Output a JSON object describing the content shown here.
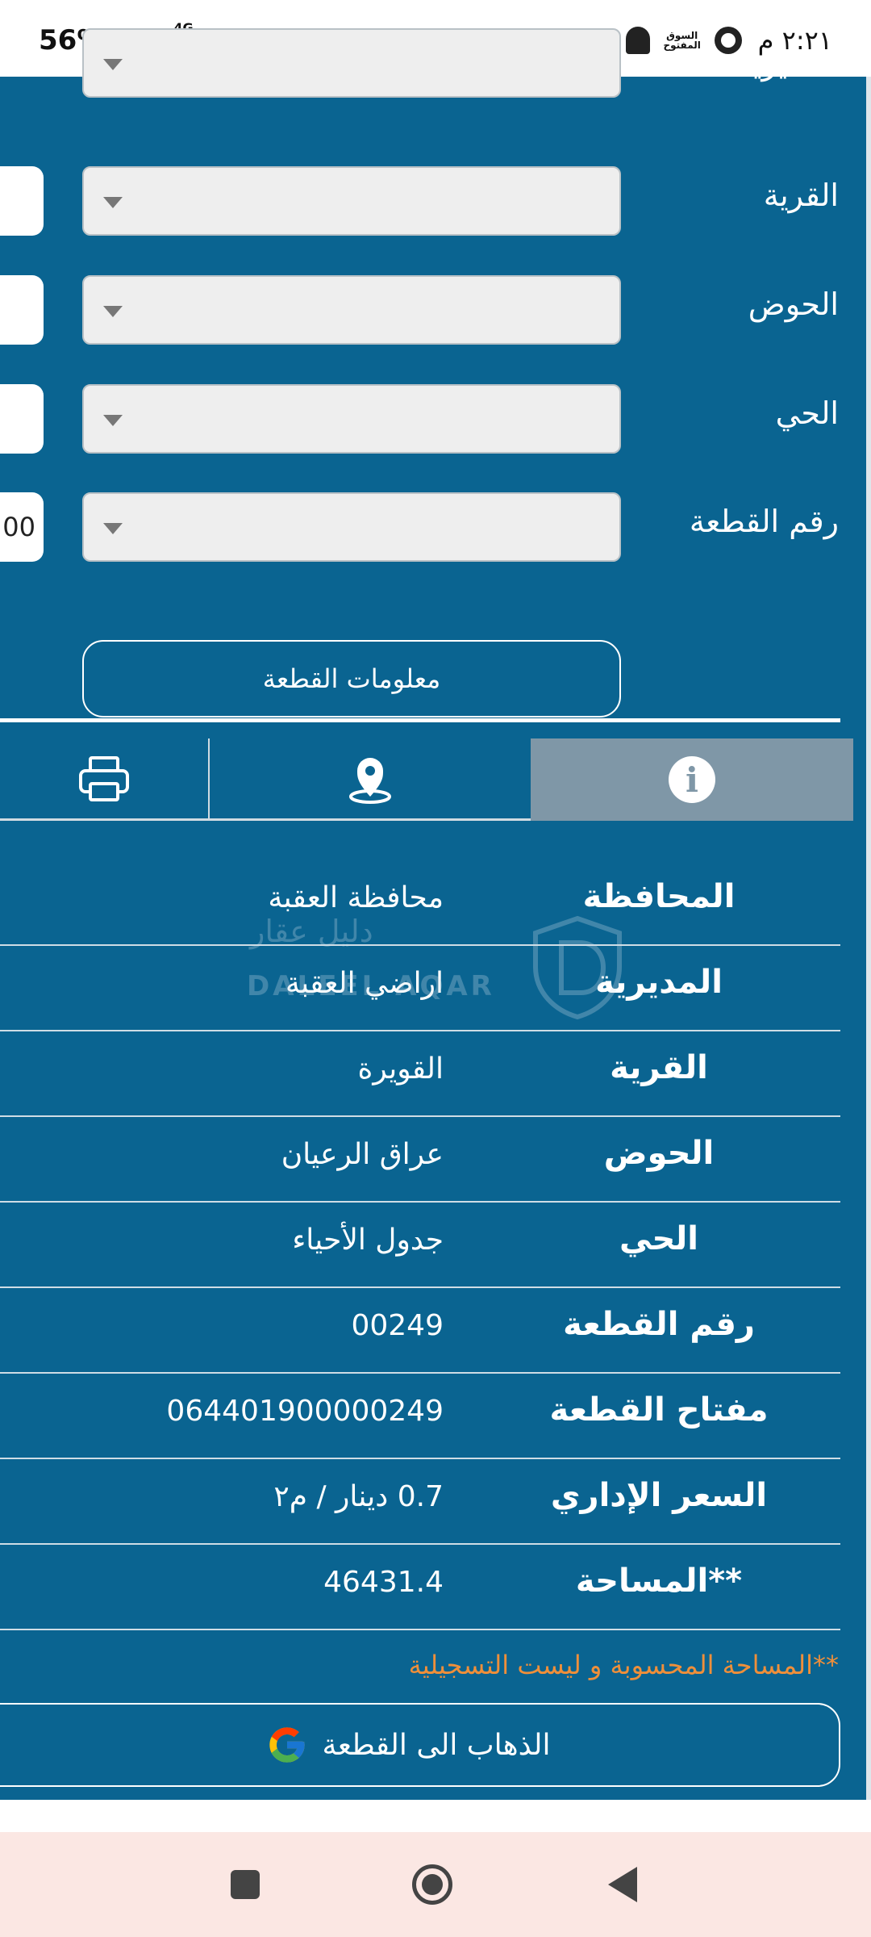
{
  "status_bar": {
    "battery_percent": "56%",
    "battery_level": 0.56,
    "network": "4G",
    "time": "٢:٢١ م",
    "souq_icon_text": "السوق المفتوح"
  },
  "form": {
    "rows": [
      {
        "label": "المديرية",
        "side_value": ""
      },
      {
        "label": "القرية",
        "side_value": ""
      },
      {
        "label": "الحوض",
        "side_value": ""
      },
      {
        "label": "الحي",
        "side_value": ""
      },
      {
        "label": "رقم القطعة",
        "side_value": "00"
      }
    ],
    "info_button_label": "معلومات القطعة"
  },
  "tabs": {
    "active": "info",
    "items": [
      {
        "id": "print",
        "icon": "printer-icon"
      },
      {
        "id": "location",
        "icon": "location-pin-icon"
      },
      {
        "id": "info",
        "icon": "info-icon",
        "glyph": "i"
      }
    ]
  },
  "details": [
    {
      "label": "المحافظة",
      "value": "محافظة العقبة"
    },
    {
      "label": "المديرية",
      "value": "اراضي العقبة"
    },
    {
      "label": "القرية",
      "value": "القويرة"
    },
    {
      "label": "الحوض",
      "value": "عراق الرعيان"
    },
    {
      "label": "الحي",
      "value": "جدول الأحياء"
    },
    {
      "label": "رقم القطعة",
      "value": "00249"
    },
    {
      "label": "مفتاح القطعة",
      "value": "064401900000249"
    },
    {
      "label": "السعر الإداري",
      "value": "0.7 دينار / م٢"
    },
    {
      "label": "**المساحة",
      "value": "46431.4"
    }
  ],
  "watermark": {
    "arabic": "دليل عقار",
    "english": "DALEEL AQAR"
  },
  "note": "**المساحة المحسوبة و ليست التسجيلية",
  "goto_button_label": "الذهاب الى القطعة",
  "colors": {
    "app_background": "#0a6491",
    "active_tab": "#7f97a7",
    "note_orange": "#ef8f3a",
    "navbar": "#fbe7e3"
  }
}
